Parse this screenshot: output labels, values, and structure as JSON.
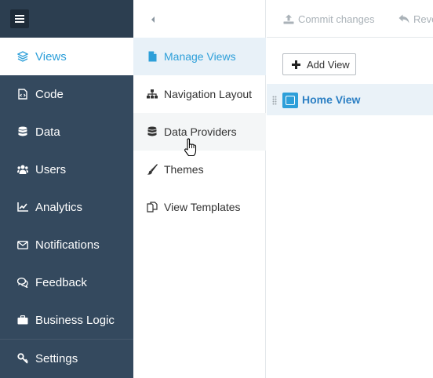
{
  "colors": {
    "sidebar_bg": "#34495e",
    "accent": "#2d9fd9",
    "active_sub_bg": "#e8f1f8"
  },
  "sidebar": {
    "menu_icon": "hamburger-icon",
    "items": [
      {
        "label": "Views",
        "icon": "layers-icon",
        "active": true
      },
      {
        "label": "Code",
        "icon": "code-file-icon"
      },
      {
        "label": "Data",
        "icon": "database-icon"
      },
      {
        "label": "Users",
        "icon": "users-icon"
      },
      {
        "label": "Analytics",
        "icon": "line-chart-icon"
      },
      {
        "label": "Notifications",
        "icon": "envelope-icon"
      },
      {
        "label": "Feedback",
        "icon": "comments-icon"
      },
      {
        "label": "Business Logic",
        "icon": "briefcase-icon"
      },
      {
        "label": "Settings",
        "icon": "key-icon"
      }
    ]
  },
  "submenu": {
    "collapse_icon": "caret-left-icon",
    "items": [
      {
        "label": "Manage Views",
        "icon": "file-icon",
        "active": true
      },
      {
        "label": "Navigation Layout",
        "icon": "sitemap-icon"
      },
      {
        "label": "Data Providers",
        "icon": "database-icon",
        "hovered": true
      },
      {
        "label": "Themes",
        "icon": "paint-brush-icon"
      },
      {
        "label": "View Templates",
        "icon": "copy-icon"
      }
    ]
  },
  "toolbar": {
    "commit_label": "Commit changes",
    "revert_label": "Reve"
  },
  "main": {
    "add_view_label": "Add View",
    "views": [
      {
        "label": "Home View"
      }
    ]
  }
}
